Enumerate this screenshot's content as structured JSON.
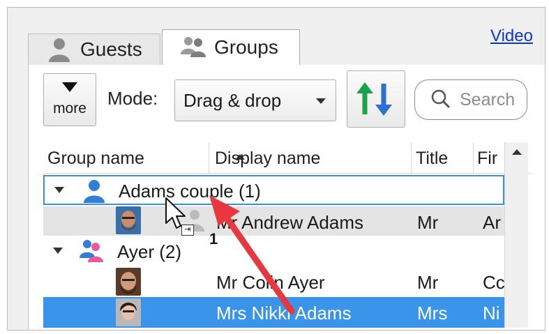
{
  "tabs": [
    {
      "label": "Guests",
      "icon": "person-icon"
    },
    {
      "label": "Groups",
      "icon": "group-icon"
    }
  ],
  "video_link": "Video",
  "toolbar": {
    "more_label": "more",
    "mode_label": "Mode:",
    "mode_value": "Drag & drop",
    "search_placeholder": "Search"
  },
  "columns": [
    "Group name",
    "Display name",
    "Title",
    "Fir"
  ],
  "rows": [
    {
      "type": "group",
      "group": "Adams couple (1)",
      "icon_color": "#2f7fd6"
    },
    {
      "type": "member",
      "display": "Mr Andrew Adams",
      "title": "Mr",
      "first": "Ar"
    },
    {
      "type": "group",
      "group": "Ayer (2)",
      "icon_color": "#e65aa0"
    },
    {
      "type": "member",
      "display": "Mr Colin Ayer",
      "title": "Mr",
      "first": "Cc"
    },
    {
      "type": "member",
      "display": "Mrs Nikki Adams",
      "title": "Mrs",
      "first": "Ni"
    }
  ],
  "drag_count": "1",
  "colors": {
    "selection": "#3a94ea",
    "focus_border": "#3c8fe0",
    "annotation_arrow": "#e8373e"
  }
}
